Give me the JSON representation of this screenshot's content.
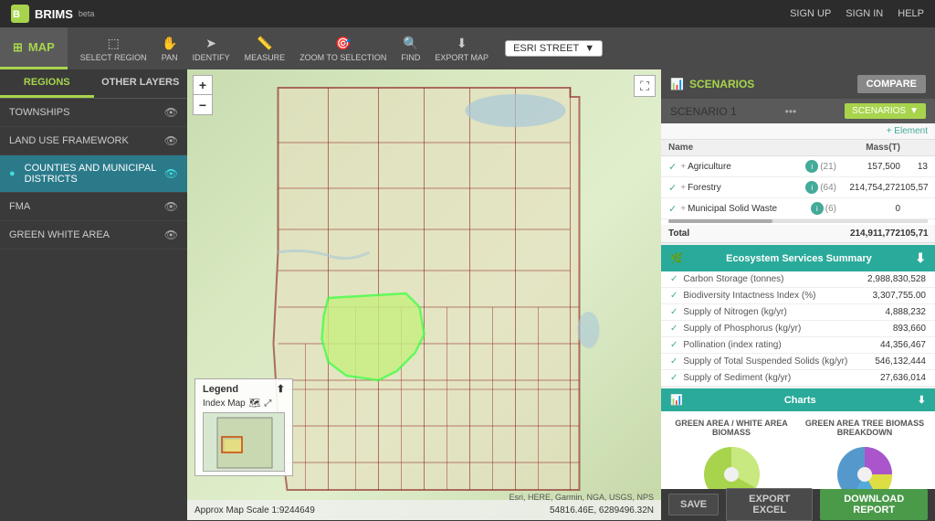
{
  "app": {
    "logo": "BRIMS",
    "beta": "beta",
    "map_tab": "MAP"
  },
  "topnav": {
    "signup": "SIGN UP",
    "signin": "SIGN IN",
    "help": "HELP"
  },
  "toolbar": {
    "select_region": "SELECT REGION",
    "pan": "PAN",
    "identify": "IDENTIFY",
    "measure": "MEASURE",
    "zoom_to_selection": "ZOOM TO SELECTION",
    "find": "FIND",
    "export_map": "EXPORT MAP",
    "basemap": "ESRI STREET"
  },
  "left_panel": {
    "tab_regions": "REGIONS",
    "tab_other": "OTHER LAYERS",
    "layers": [
      {
        "name": "TOWNSHIPS",
        "active": false
      },
      {
        "name": "LAND USE FRAMEWORK",
        "active": false
      },
      {
        "name": "COUNTIES AND MUNICIPAL DISTRICTS",
        "active": true
      },
      {
        "name": "FMA",
        "active": false
      },
      {
        "name": "GREEN WHITE AREA",
        "active": false
      }
    ]
  },
  "right_panel": {
    "scenarios_title": "SCENARIOS",
    "compare_btn": "COMPARE",
    "scenario_name": "SCENARIO 1",
    "scenarios_btn": "SCENARIOS",
    "element_label": "+ Element",
    "columns": {
      "name": "Name",
      "mass": "Mass(T)",
      "num": ""
    },
    "elements": [
      {
        "name": "Agriculture",
        "info": true,
        "count": "(21)",
        "mass": "157,500",
        "num": "13"
      },
      {
        "name": "Forestry",
        "info": true,
        "count": "(64)",
        "mass": "214,754,272",
        "num": "105,57"
      },
      {
        "name": "Municipal Solid Waste",
        "info": true,
        "count": "(6)",
        "mass": "0",
        "num": ""
      }
    ],
    "total_mass": "214,911,772",
    "total_num": "105,71",
    "ecosystem_services": {
      "title": "Ecosystem Services Summary",
      "rows": [
        {
          "name": "Carbon Storage (tonnes)",
          "value": "2,988,830,528"
        },
        {
          "name": "Biodiversity Intactness Index (%)",
          "value": "3,307,755.00"
        },
        {
          "name": "Supply of Nitrogen (kg/yr)",
          "value": "4,888,232"
        },
        {
          "name": "Supply of Phosphorus (kg/yr)",
          "value": "893,660"
        },
        {
          "name": "Pollination (index rating)",
          "value": "44,356,467"
        },
        {
          "name": "Supply of Total Suspended Solids (kg/yr)",
          "value": "546,132,444"
        },
        {
          "name": "Supply of Sediment (kg/yr)",
          "value": "27,636,014"
        }
      ]
    },
    "charts": {
      "title": "Charts",
      "chart1_label": "GREEN AREA / WHITE AREA BIOMASS",
      "chart2_label": "GREEN AREA TREE BIOMASS BREAKDOWN"
    },
    "actions": {
      "save": "SAVE",
      "export_excel": "EXPORT EXCEL",
      "download_report": "DOWNLOAD REPORT"
    }
  },
  "map": {
    "scale_label": "Approx Map Scale 1:9244649",
    "coords": "54816.46E, 6289496.32N",
    "attribution": "Esri, HERE, Garmin, NGA, USGS, NPS",
    "legend_title": "Legend",
    "index_map": "Index Map",
    "zoom_in": "+",
    "zoom_out": "−"
  }
}
